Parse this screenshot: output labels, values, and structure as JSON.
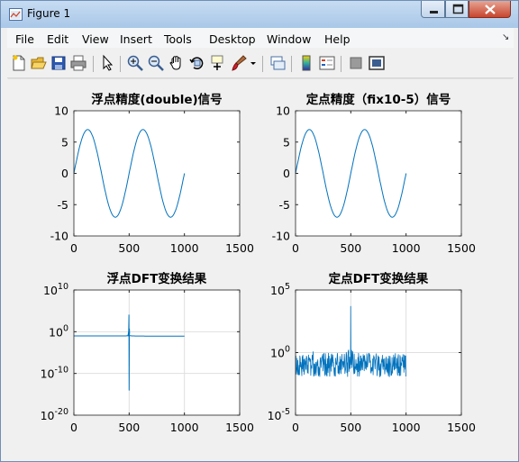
{
  "window": {
    "title": "Figure 1"
  },
  "menu": [
    "File",
    "Edit",
    "View",
    "Insert",
    "Tools",
    "Desktop",
    "Window",
    "Help"
  ],
  "toolbar": [
    "new-figure-icon",
    "open-file-icon",
    "save-icon",
    "print-icon",
    "edit-plot-arrow-icon",
    "zoom-in-icon",
    "zoom-out-icon",
    "pan-hand-icon",
    "rotate-3d-icon",
    "data-cursor-icon",
    "brush-icon",
    "brush-dropdown-icon",
    "link-plot-icon",
    "insert-colorbar-icon",
    "insert-legend-icon",
    "hide-plot-tools-icon",
    "show-plot-tools-icon"
  ],
  "colors": {
    "line": "#0072bd",
    "grid": "#dfdfdf",
    "axes_bg": "#ffffff"
  },
  "chart_data": [
    {
      "type": "line",
      "title": "浮点精度(double)信号",
      "xlim": [
        0,
        1500
      ],
      "ylim": [
        -10,
        10
      ],
      "xticks": [
        "0",
        "500",
        "1000",
        "1500"
      ],
      "yticks": [
        "10",
        "5",
        "0",
        "-5",
        "-10"
      ],
      "xtick_values": [
        0,
        500,
        1000,
        1500
      ],
      "ytick_values": [
        10,
        5,
        0,
        -5,
        -10
      ],
      "grid": false,
      "series": [
        {
          "function": "7*sin(2*pi*x/500)",
          "x_range": [
            0,
            1000
          ],
          "amplitude": 7,
          "period": 500
        }
      ]
    },
    {
      "type": "line",
      "title": "定点精度（fix10-5）信号",
      "xlim": [
        0,
        1500
      ],
      "ylim": [
        -10,
        10
      ],
      "xticks": [
        "0",
        "500",
        "1000",
        "1500"
      ],
      "yticks": [
        "10",
        "5",
        "0",
        "-5",
        "-10"
      ],
      "xtick_values": [
        0,
        500,
        1000,
        1500
      ],
      "ytick_values": [
        10,
        5,
        0,
        -5,
        -10
      ],
      "grid": false,
      "series": [
        {
          "function": "7*sin(2*pi*x/500)",
          "x_range": [
            0,
            1000
          ],
          "amplitude": 7,
          "period": 500
        }
      ]
    },
    {
      "type": "line",
      "title": "浮点DFT变换结果",
      "xlim": [
        0,
        1500
      ],
      "ylim": [
        1e-20,
        10000000000.0
      ],
      "yscale": "log",
      "xticks": [
        "0",
        "500",
        "1000",
        "1500"
      ],
      "yticks": [
        "10^10",
        "10^0",
        "10^-10",
        "10^-20"
      ],
      "xtick_values": [
        0,
        500,
        1000,
        1500
      ],
      "ytick_exponents": [
        10,
        0,
        -10,
        -20
      ],
      "grid": true,
      "series": [
        {
          "description": "flat ~10^-1 baseline with spike to ~10^4 and dip to ~10^-14 near x=500",
          "x_range": [
            0,
            1000
          ],
          "baseline": 0.1,
          "peak_x": 500,
          "peak": 10000,
          "dip": 1e-14
        }
      ]
    },
    {
      "type": "line",
      "title": "定点DFT变换结果",
      "xlim": [
        0,
        1500
      ],
      "ylim": [
        1e-05,
        100000.0
      ],
      "yscale": "log",
      "xticks": [
        "0",
        "500",
        "1000",
        "1500"
      ],
      "yticks": [
        "10^5",
        "10^0",
        "10^-5"
      ],
      "xtick_values": [
        0,
        500,
        1000,
        1500
      ],
      "ytick_exponents": [
        5,
        0,
        -5
      ],
      "grid": true,
      "series": [
        {
          "description": "noisy floor around 10^-1 with spike to ~10^4 near x=500",
          "x_range": [
            0,
            1000
          ],
          "baseline": 0.1,
          "peak_x": 500,
          "peak": 5000
        }
      ]
    }
  ]
}
